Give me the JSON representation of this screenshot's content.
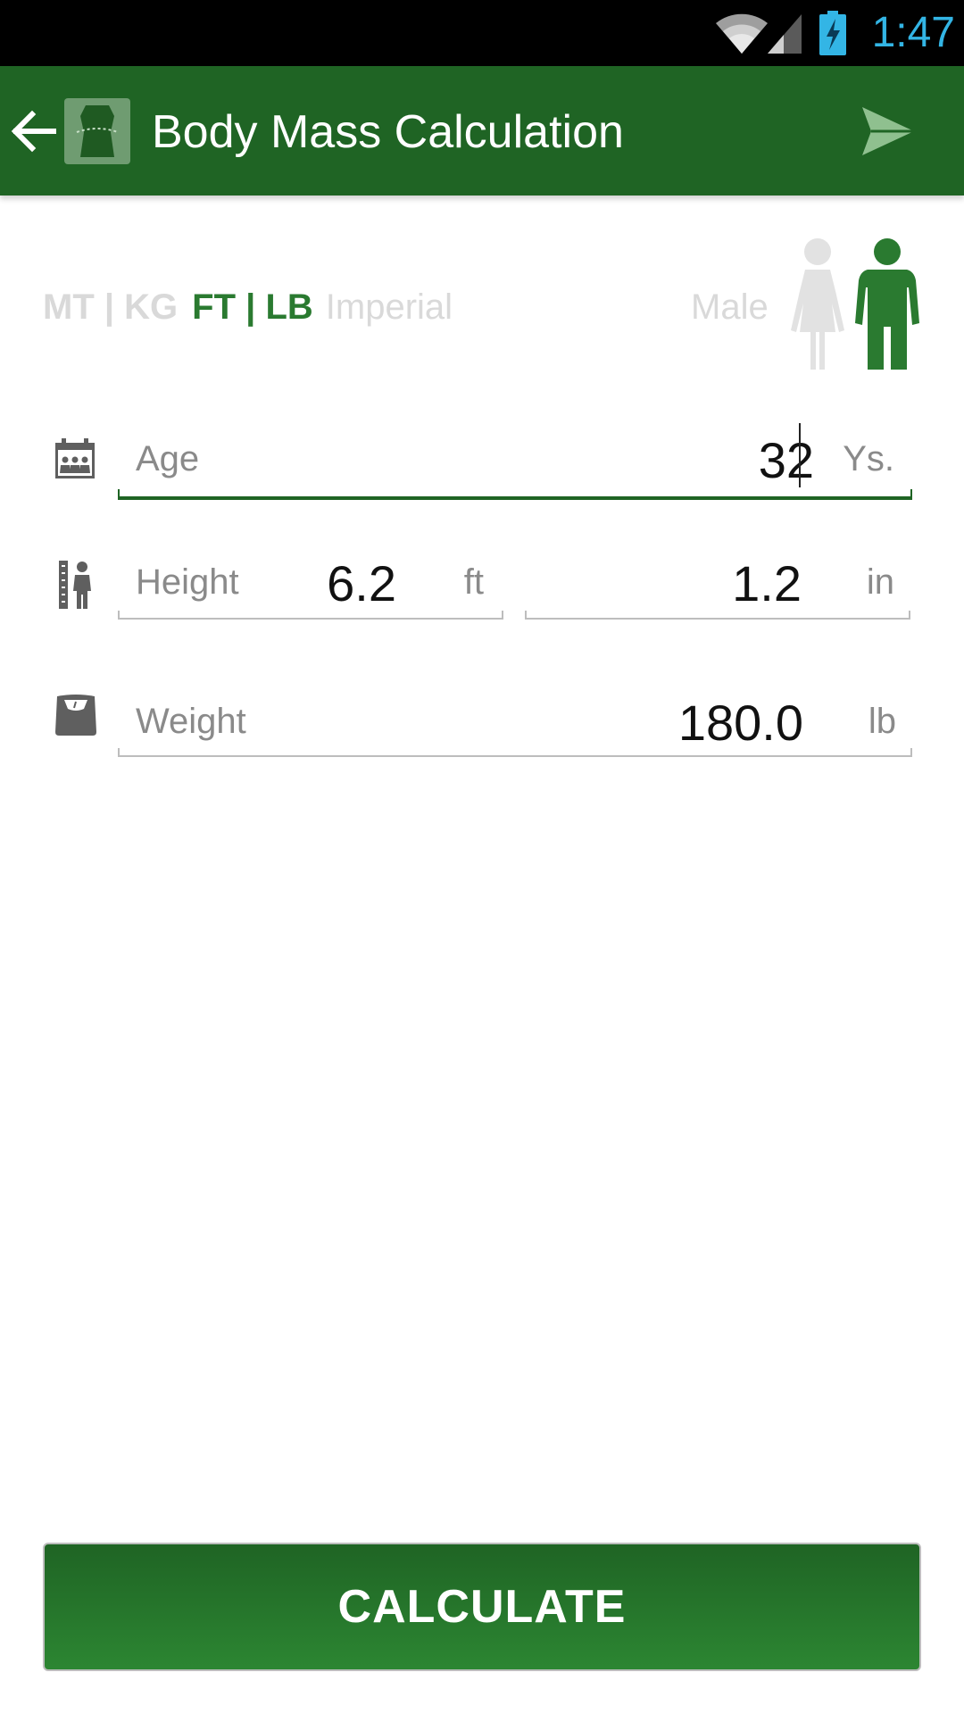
{
  "status_bar": {
    "time": "1:47"
  },
  "header": {
    "title": "Body Mass Calculation"
  },
  "units": {
    "metric": "MT | KG",
    "feet_pounds": "FT | LB",
    "imperial": "Imperial",
    "selected": "FT | LB"
  },
  "gender": {
    "label": "Male",
    "selected": "male"
  },
  "fields": {
    "age": {
      "label": "Age",
      "value": "32",
      "unit": "Ys."
    },
    "height": {
      "label": "Height",
      "feet_value": "6.2",
      "feet_unit": "ft",
      "inch_value": "1.2",
      "inch_unit": "in"
    },
    "weight": {
      "label": "Weight",
      "value": "180.0",
      "unit": "lb"
    }
  },
  "calculate_button": {
    "label": "CALCULATE"
  },
  "colors": {
    "primary": "#1f6424",
    "accent_green": "#2a7a30",
    "status_time": "#33b5e5",
    "inactive": "#d9d9d9"
  },
  "icons": {
    "back": "arrow-left-icon",
    "logo": "body-torso-icon",
    "send": "send-icon",
    "female": "female-figure-icon",
    "male": "male-figure-icon",
    "age": "calendar-people-icon",
    "height": "ruler-person-icon",
    "weight": "scale-icon"
  }
}
